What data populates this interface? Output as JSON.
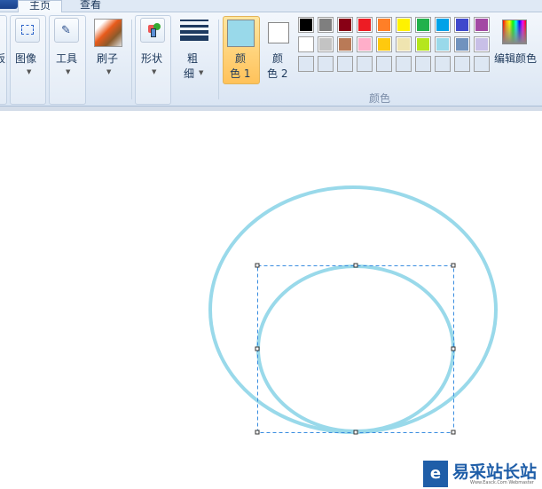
{
  "tabs": [
    {
      "label": "主页",
      "active": true
    },
    {
      "label": "查看",
      "active": false
    }
  ],
  "groups": {
    "clipboard_partial": "板",
    "image": "图像",
    "tools": "工具",
    "brushes": "刷子",
    "shapes": "形状",
    "size": [
      "粗",
      "细"
    ],
    "color1": [
      "颜",
      "色 1"
    ],
    "color2": [
      "颜",
      "色 2"
    ],
    "edit_colors": "编辑颜色",
    "colors_group_label": "颜色"
  },
  "color1": "#99d9ea",
  "color2": "#ffffff",
  "palette": [
    [
      "#000000",
      "#7f7f7f",
      "#880015",
      "#ed1c24",
      "#ff7f27",
      "#fff200",
      "#22b14c",
      "#00a2e8",
      "#3f48cc",
      "#a349a4"
    ],
    [
      "#ffffff",
      "#c3c3c3",
      "#b97a57",
      "#ffaec9",
      "#ffc90e",
      "#efe4b0",
      "#b5e61d",
      "#99d9ea",
      "#7092be",
      "#c8bfe7"
    ],
    [
      null,
      null,
      null,
      null,
      null,
      null,
      null,
      null,
      null,
      null
    ]
  ],
  "canvas": {
    "stroke_color": "#99d9ea"
  },
  "watermark": {
    "title": "易采站长站",
    "subtitle": "Www.Easck.Com Webmaster"
  }
}
